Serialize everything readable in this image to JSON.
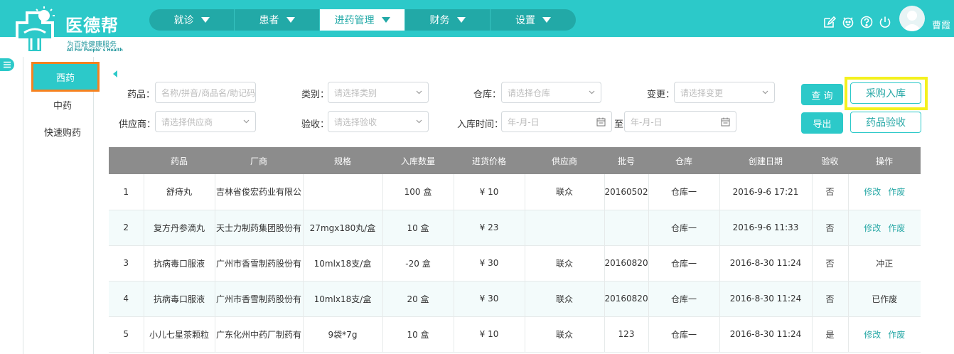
{
  "brand": {
    "title": "医德帮",
    "subtitle": "为百姓健康服务",
    "subtitle_en": "All For People' s Health"
  },
  "nav": [
    "就诊",
    "患者",
    "进药管理",
    "财务",
    "设置"
  ],
  "nav_active_index": 2,
  "user": {
    "name": "曹霞"
  },
  "header_icons": [
    "edit-icon",
    "bell-icon",
    "help-icon",
    "power-icon"
  ],
  "sidebar": {
    "items": [
      "西药",
      "中药",
      "快速购药"
    ],
    "active_index": 0
  },
  "filters": {
    "drug_label": "药品：",
    "drug_placeholder": "名称/拼音/商品名/助记码",
    "category_label": "类别：",
    "category_placeholder": "请选择类别",
    "warehouse_label": "仓库：",
    "warehouse_placeholder": "请选择仓库",
    "change_label": "变更：",
    "change_placeholder": "请选择变更",
    "supplier_label": "供应商：",
    "supplier_placeholder": "请选择供应商",
    "check_label": "验收：",
    "check_placeholder": "请选择验收",
    "time_label": "入库时间：",
    "date_placeholder": "年-月-日",
    "to_label": "至"
  },
  "buttons": {
    "query": "查 询",
    "purchase_in": "采购入库",
    "export": "导出",
    "drug_check": "药品验收"
  },
  "colors": {
    "primary": "#2cc9c9",
    "nav_bg": "#22a9a7",
    "header_row": "#8c8c8c",
    "highlight_orange": "#f58220",
    "highlight_yellow": "#f4f11e"
  },
  "table": {
    "headers": [
      "",
      "药品",
      "厂商",
      "规格",
      "入库数量",
      "进货价格",
      "供应商",
      "批号",
      "仓库",
      "创建日期",
      "验收",
      "操作"
    ],
    "rows": [
      {
        "no": "1",
        "drug": "舒痔丸",
        "maker": "吉林省俊宏药业有限公",
        "spec": "",
        "qty": "100 盒",
        "price": "¥ 10",
        "supplier": "联众",
        "batch": "20160502",
        "warehouse": "仓库一",
        "date": "2016-9-6 17:21",
        "check": "否",
        "ops": [
          "修改",
          "作废"
        ]
      },
      {
        "no": "2",
        "drug": "复方丹参滴丸",
        "maker": "天士力制药集团股份有",
        "spec": "27mgx180丸/盒",
        "qty": "10 盒",
        "price": "¥ 23",
        "supplier": "",
        "batch": "",
        "warehouse": "仓库一",
        "date": "2016-9-6 11:33",
        "check": "否",
        "ops": [
          "修改",
          "作废"
        ]
      },
      {
        "no": "3",
        "drug": "抗病毒口服液",
        "maker": "广州市香雪制药股份有",
        "spec": "10mlx18支/盒",
        "qty": "-20 盒",
        "price": "¥ 30",
        "supplier": "联众",
        "batch": "20160820",
        "warehouse": "仓库一",
        "date": "2016-8-30 11:24",
        "check": "否",
        "status": "冲正"
      },
      {
        "no": "4",
        "drug": "抗病毒口服液",
        "maker": "广州市香雪制药股份有",
        "spec": "10mlx18支/盒",
        "qty": "20 盒",
        "price": "¥ 30",
        "supplier": "联众",
        "batch": "20160820",
        "warehouse": "仓库一",
        "date": "2016-8-30 11:24",
        "check": "否",
        "status": "已作废"
      },
      {
        "no": "5",
        "drug": "小儿七星茶颗粒",
        "maker": "广东化州中药厂制药有",
        "spec": "9袋*7g",
        "qty": "10 盒",
        "price": "¥ 10",
        "supplier": "联众",
        "batch": "123",
        "warehouse": "仓库一",
        "date": "2016-8-30 11:24",
        "check": "是",
        "ops": [
          "修改",
          "作废"
        ]
      }
    ]
  }
}
